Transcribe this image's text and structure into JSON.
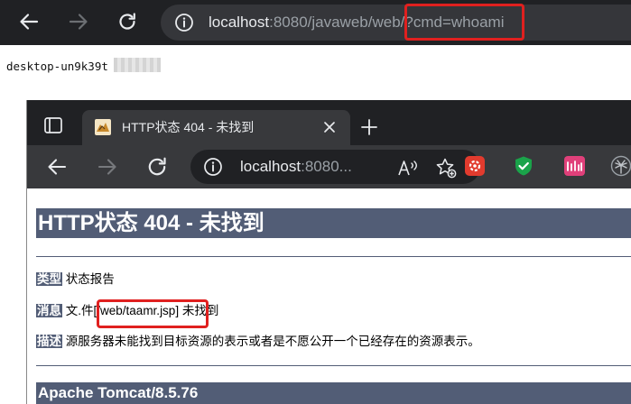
{
  "outer_browser": {
    "url_host": "localhost",
    "url_rest": ":8080/javaweb/web/",
    "url_query": "?cmd=whoami"
  },
  "command_output": "desktop-un9k39t",
  "inner_browser": {
    "tab_title": "HTTP状态 404 - 未找到",
    "url_host": "localhost",
    "url_rest": ":8080...",
    "extensions": [
      "red-gear-extension",
      "green-shield-extension",
      "pink-extension",
      "palm-extension"
    ],
    "accent_colors": {
      "tomcat_blue": "#525d76",
      "highlight_red": "#e0201f"
    }
  },
  "error_page": {
    "heading": "HTTP状态 404 - 未找到",
    "type_label": "类型",
    "type_value": "状态报告",
    "message_label": "消息",
    "message_prefix": "文.件",
    "message_path": "[/web/taamr.jsp]",
    "message_suffix": "未找到",
    "description_label": "描述",
    "description_value": "源服务器未能找到目标资源的表示或者是不愿公开一个已经存在的资源表示。",
    "footer": "Apache Tomcat/8.5.76"
  }
}
